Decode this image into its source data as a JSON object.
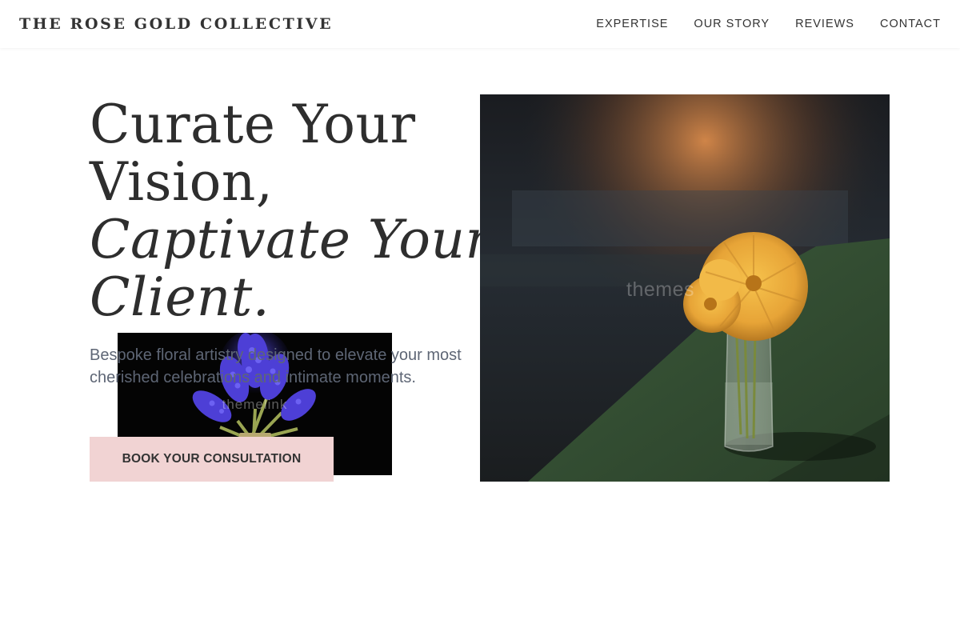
{
  "header": {
    "brand": "THE ROSE GOLD COLLECTIVE",
    "nav": [
      {
        "label": "EXPERTISE"
      },
      {
        "label": "OUR STORY"
      },
      {
        "label": "REVIEWS"
      },
      {
        "label": "CONTACT"
      }
    ]
  },
  "hero": {
    "title_line1": "Curate Your",
    "title_line2": "Vision,",
    "title_line3": "Captivate Your",
    "title_line4": "Client.",
    "subtitle": "Bespoke floral artistry designed to elevate your most cherished celebrations and intimate moments.",
    "cta_label": "BOOK YOUR CONSULTATION",
    "main_image_watermark": "themes",
    "small_image_watermark": "themelink"
  },
  "colors": {
    "accent": "#f1d3d3",
    "text": "#2e2e2e",
    "subtitle": "#5e6675"
  }
}
